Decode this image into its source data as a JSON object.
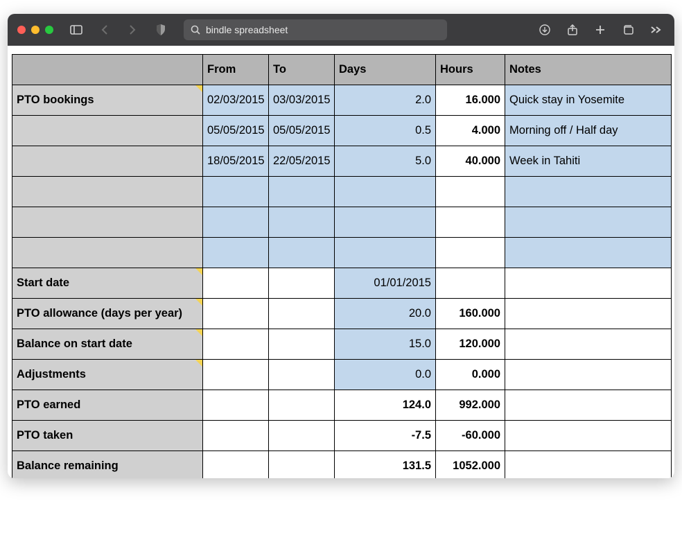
{
  "browser": {
    "search_value": "bindle spreadsheet"
  },
  "headers": {
    "from": "From",
    "to": "To",
    "days": "Days",
    "hours": "Hours",
    "notes": "Notes"
  },
  "bookings_label": "PTO bookings",
  "bookings": [
    {
      "from": "02/03/2015",
      "to": "03/03/2015",
      "days": "2.0",
      "hours": "16.000",
      "notes": "Quick stay in Yosemite"
    },
    {
      "from": "05/05/2015",
      "to": "05/05/2015",
      "days": "0.5",
      "hours": "4.000",
      "notes": "Morning off / Half day"
    },
    {
      "from": "18/05/2015",
      "to": "22/05/2015",
      "days": "5.0",
      "hours": "40.000",
      "notes": "Week in Tahiti"
    }
  ],
  "summary": {
    "start_date": {
      "label": "Start date",
      "days": "01/01/2015",
      "hours": ""
    },
    "pto_allowance": {
      "label": "PTO allowance (days per year)",
      "days": "20.0",
      "hours": "160.000"
    },
    "balance_start": {
      "label": "Balance on start date",
      "days": "15.0",
      "hours": "120.000"
    },
    "adjustments": {
      "label": "Adjustments",
      "days": "0.0",
      "hours": "0.000"
    },
    "pto_earned": {
      "label": "PTO earned",
      "days": "124.0",
      "hours": "992.000"
    },
    "pto_taken": {
      "label": "PTO taken",
      "days": "-7.5",
      "hours": "-60.000"
    },
    "balance_remain": {
      "label": "Balance remaining",
      "days": "131.5",
      "hours": "1052.000"
    }
  }
}
